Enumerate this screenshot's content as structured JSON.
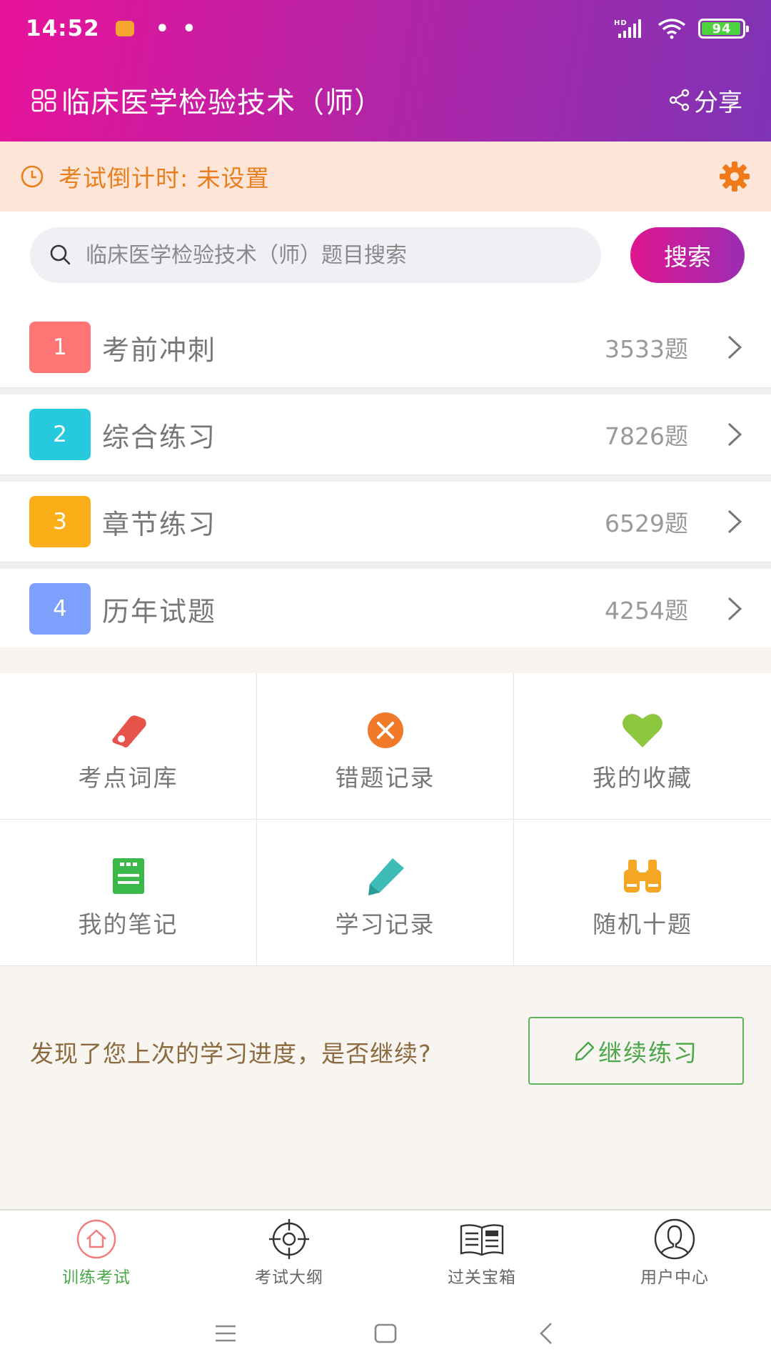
{
  "status_bar": {
    "time": "14:52",
    "dots": "• •",
    "network": "HD",
    "battery": "94"
  },
  "header": {
    "title": "临床医学检验技术（师）",
    "share_label": "分享"
  },
  "countdown": {
    "text": "考试倒计时: 未设置"
  },
  "search": {
    "placeholder": "临床医学检验技术（师）题目搜索",
    "button_label": "搜索"
  },
  "categories": [
    {
      "index": "1",
      "label": "考前冲刺",
      "count": "3533题",
      "color": "#ff7474"
    },
    {
      "index": "2",
      "label": "综合练习",
      "count": "7826题",
      "color": "#27c9de"
    },
    {
      "index": "3",
      "label": "章节练习",
      "count": "6529题",
      "color": "#fbae17"
    },
    {
      "index": "4",
      "label": "历年试题",
      "count": "4254题",
      "color": "#7f9ffd"
    }
  ],
  "features": [
    {
      "label": "考点词库",
      "icon": "tag-icon",
      "color": "#e5534b"
    },
    {
      "label": "错题记录",
      "icon": "close-circle-icon",
      "color": "#f07a2a"
    },
    {
      "label": "我的收藏",
      "icon": "heart-icon",
      "color": "#8dc63f"
    },
    {
      "label": "我的笔记",
      "icon": "note-icon",
      "color": "#3bb84a"
    },
    {
      "label": "学习记录",
      "icon": "pencil-icon",
      "color": "#3ebcb6"
    },
    {
      "label": "随机十题",
      "icon": "binoculars-icon",
      "color": "#f5a623"
    }
  ],
  "resume": {
    "prompt": "发现了您上次的学习进度，是否继续?",
    "button_label": "继续练习"
  },
  "tabs": [
    {
      "label": "训练考试",
      "icon": "home-icon",
      "active": true
    },
    {
      "label": "考试大纲",
      "icon": "target-icon",
      "active": false
    },
    {
      "label": "过关宝箱",
      "icon": "news-icon",
      "active": false
    },
    {
      "label": "用户中心",
      "icon": "user-icon",
      "active": false
    }
  ],
  "colors": {
    "header_start": "#e8129a",
    "header_end": "#7f33b5",
    "accent_green": "#4aa84a",
    "countdown_text": "#e87f1e"
  }
}
